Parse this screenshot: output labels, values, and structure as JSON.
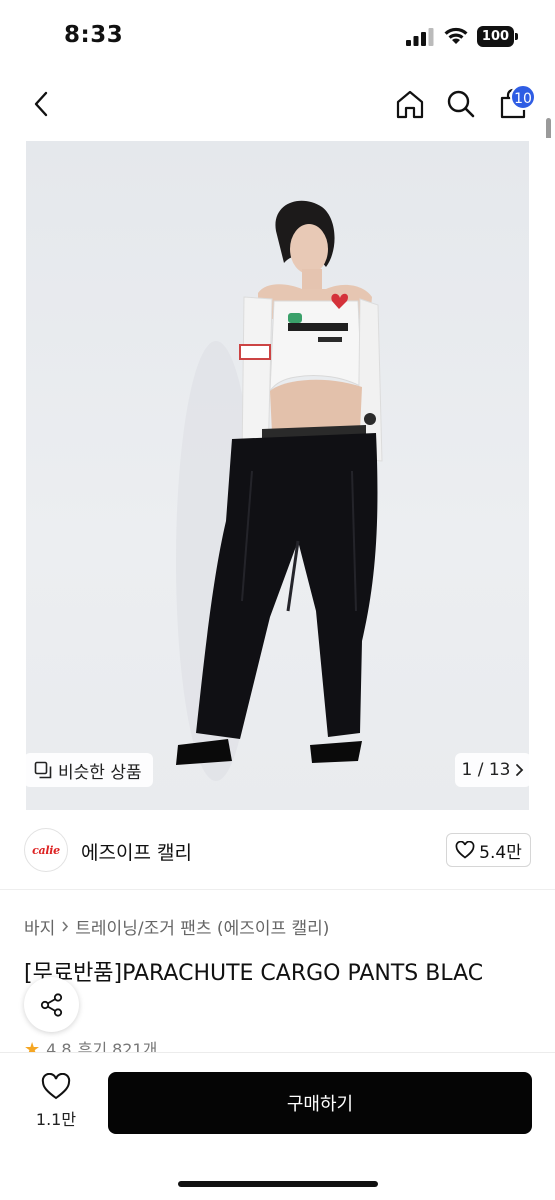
{
  "status_bar": {
    "time": "8:33",
    "battery": "100"
  },
  "nav": {
    "cart_count": "10",
    "icons": [
      "back-chevron-icon",
      "home-icon",
      "search-icon",
      "shopping-bag-icon"
    ]
  },
  "gallery": {
    "similar_label": "비슷한 상품",
    "pager": "1 / 13"
  },
  "shop": {
    "logo_text": "calie",
    "name": "에즈이프 캘리",
    "likes": "5.4만"
  },
  "breadcrumb": {
    "items": [
      "바지",
      "트레이닝/조거 팬츠 (에즈이프 캘리)"
    ]
  },
  "product": {
    "title": "[무료반품]PARACHUTE CARGO PANTS BLAC",
    "rating": "4.8",
    "reviews": "후기 821개"
  },
  "bottom_bar": {
    "wish_count": "1.1만",
    "buy_label": "구매하기"
  },
  "colors": {
    "accent_badge": "#2f5de4",
    "buy_button": "#050505",
    "star": "#f5a623"
  }
}
